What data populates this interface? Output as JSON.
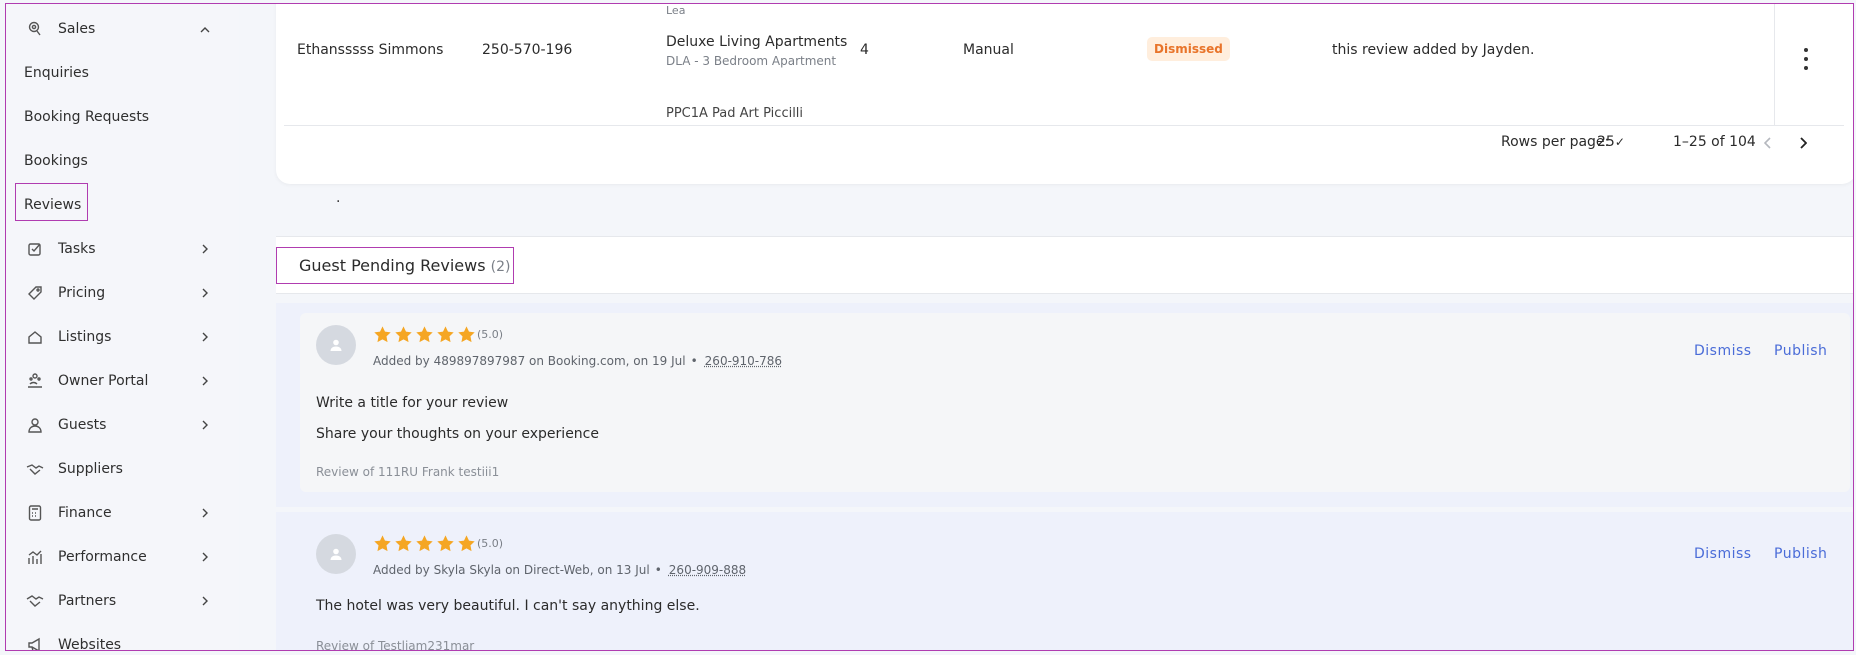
{
  "sidebar": {
    "items": [
      {
        "label": "Sales",
        "icon": "sales-icon",
        "expanded": true
      },
      {
        "label": "Enquiries"
      },
      {
        "label": "Booking Requests"
      },
      {
        "label": "Bookings"
      },
      {
        "label": "Reviews",
        "selected": true
      },
      {
        "label": "Tasks",
        "icon": "task-icon"
      },
      {
        "label": "Pricing",
        "icon": "tag-icon"
      },
      {
        "label": "Listings",
        "icon": "home-icon"
      },
      {
        "label": "Owner Portal",
        "icon": "owner-icon"
      },
      {
        "label": "Guests",
        "icon": "person-icon"
      },
      {
        "label": "Suppliers",
        "icon": "handshake-icon"
      },
      {
        "label": "Finance",
        "icon": "calculator-icon"
      },
      {
        "label": "Performance",
        "icon": "chart-icon"
      },
      {
        "label": "Partners",
        "icon": "partners-icon"
      },
      {
        "label": "Websites",
        "icon": "megaphone-icon"
      }
    ]
  },
  "table": {
    "top_cut_text": "Lea",
    "row": {
      "guest": "Ethansssss Simmons",
      "phone": "250-570-196",
      "property": "Deluxe Living Apartments",
      "unit": "DLA - 3 Bedroom Apartment",
      "rating": "4",
      "source": "Manual",
      "status": "Dismissed",
      "comment": "this review added by Jayden."
    },
    "bottom_cut_text": "PPC1A Pad Art Piccilli",
    "rows_per_page_label": "Rows per page:",
    "rows_per_page_value": "25",
    "range": "1–25 of 104"
  },
  "stray_text": ".",
  "pending": {
    "title": "Guest Pending Reviews",
    "count": "(2)",
    "reviews": [
      {
        "rating": "(5.0)",
        "stars": 5,
        "meta": "Added by 489897897987 on Booking.com, on 19 Jul",
        "bullet": "•",
        "phone": "260-910-786",
        "title": "Write a title for your review",
        "body": "Share your thoughts on your experience",
        "review_of": "Review of 111RU Frank testiii1",
        "dismiss": "Dismiss",
        "publish": "Publish"
      },
      {
        "rating": "(5.0)",
        "stars": 5,
        "meta": "Added by Skyla Skyla on Direct-Web, on 13 Jul",
        "bullet": "•",
        "phone": "260-909-888",
        "title": "The hotel was very beautiful. I can't say anything else.",
        "review_of": "Review of Testliam231mar",
        "dismiss": "Dismiss",
        "publish": "Publish"
      }
    ]
  },
  "colors": {
    "accent": "#4a6cd8",
    "star": "#f5a623",
    "badge_text": "#e8742a",
    "badge_bg": "#ffeedd",
    "highlight_border": "#b03cb0"
  }
}
